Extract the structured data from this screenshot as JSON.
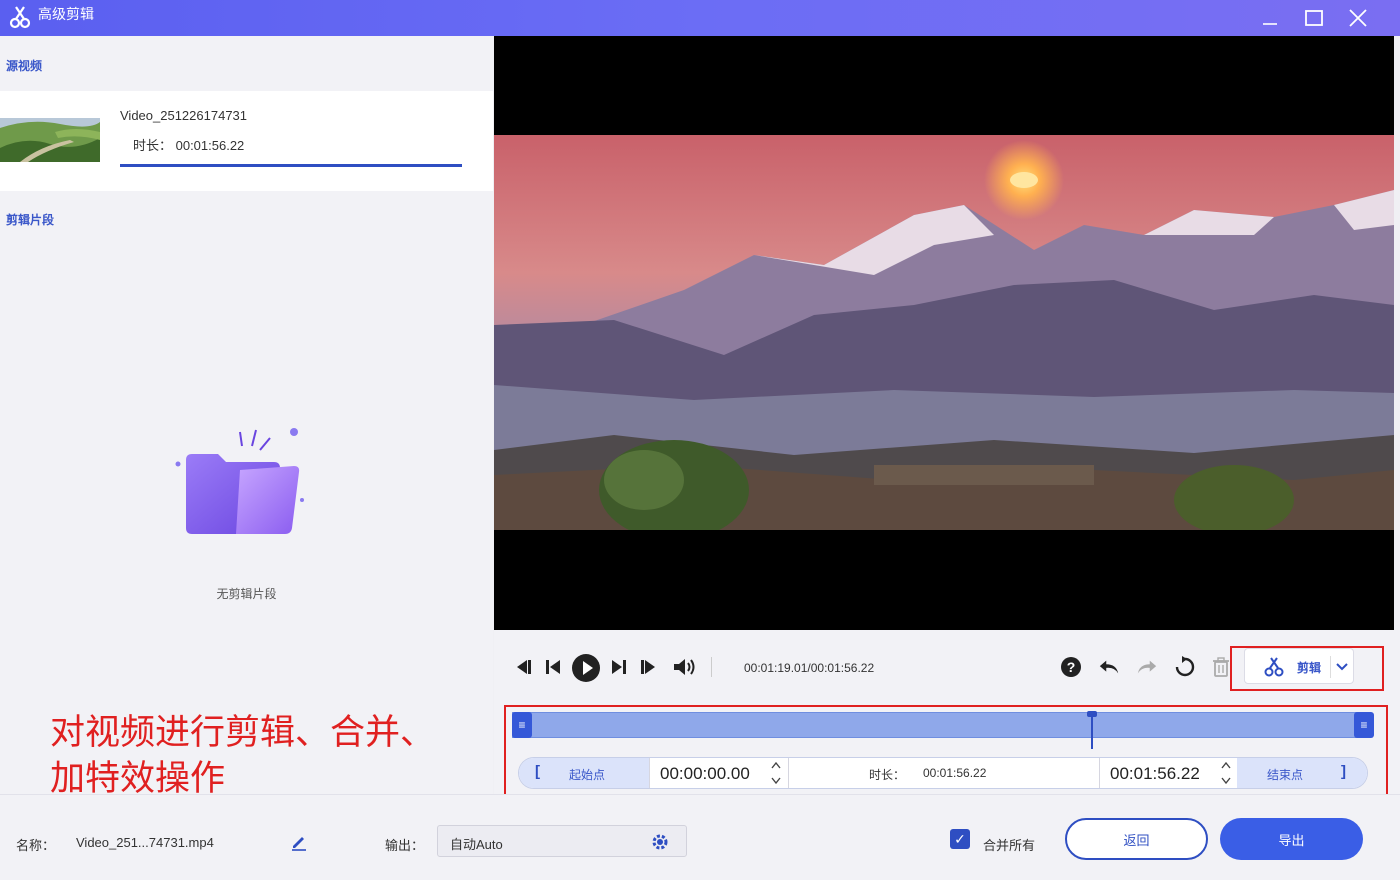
{
  "window": {
    "title": "高级剪辑",
    "minimize": "–",
    "maximize": "☐",
    "close": "✕"
  },
  "left_panel": {
    "source_label": "源视频",
    "video_name": "Video_251226174731",
    "video_duration": "时长：  00:01:56.22",
    "load_progress": 1.0,
    "clips_label": "剪辑片段",
    "empty_text": "无剪辑片段"
  },
  "annotation": {
    "line1": "对视频进行剪辑、合并、",
    "line2": "加特效操作"
  },
  "player": {
    "time_readout": "00:01:19.01/00:01:56.22",
    "cut_label": "剪辑"
  },
  "timeline": {
    "playhead_fraction": 0.68,
    "start_label": "起始点",
    "start_time": "00:00:00.00",
    "duration_label": "时长：",
    "duration_value": "00:01:56.22",
    "end_time": "00:01:56.22",
    "end_label": "结束点"
  },
  "bottom": {
    "name_label": "名称：",
    "name_value": "Video_251...74731.mp4",
    "output_label": "输出：",
    "output_value": "自动Auto",
    "merge_label": "合并所有",
    "merge_checked": true,
    "back_label": "返回",
    "export_label": "导出"
  },
  "colors": {
    "accent": "#2e4ec2",
    "annotation_red": "#e02020",
    "titlebar": "#6366f1"
  }
}
